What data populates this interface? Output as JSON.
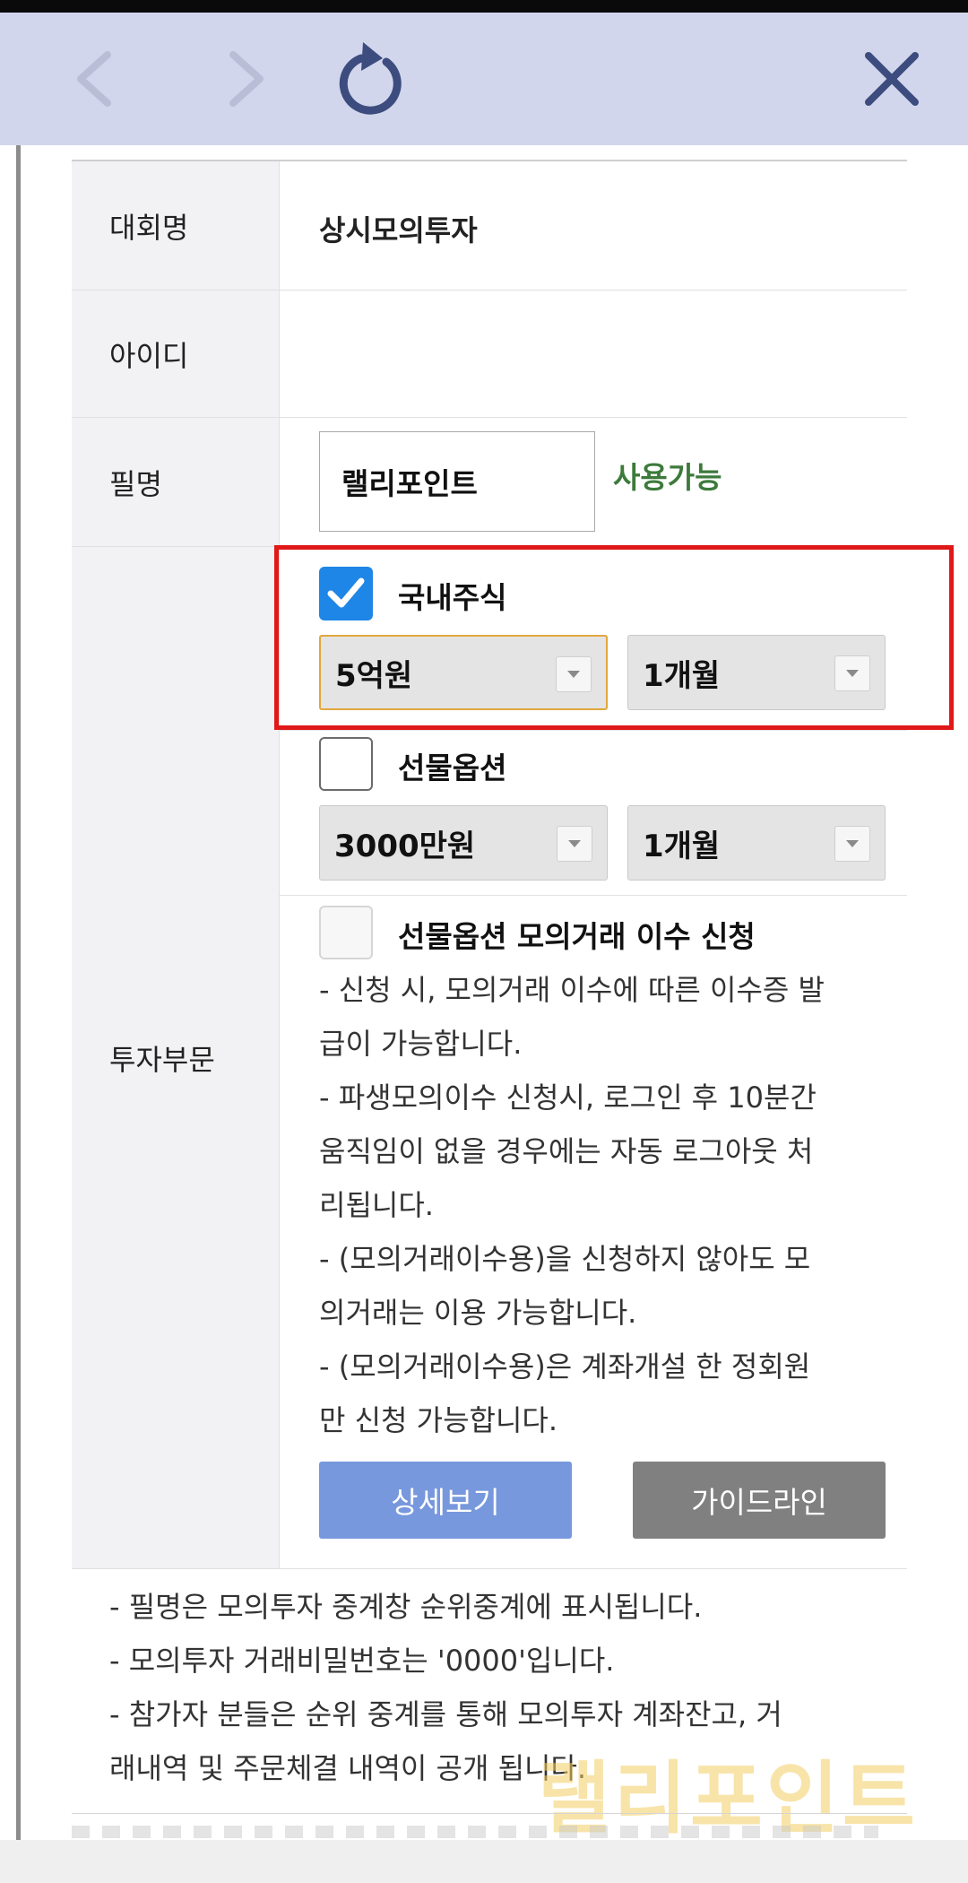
{
  "nav": {
    "back_icon": "chevron-left-icon",
    "forward_icon": "chevron-right-icon",
    "reload_icon": "reload-icon",
    "close_icon": "close-icon"
  },
  "form": {
    "contest_label": "대회명",
    "contest_value": "상시모의투자",
    "id_label": "아이디",
    "id_value": "",
    "nickname_label": "필명",
    "nickname_value": "랠리포인트",
    "nickname_status": "사용가능",
    "invest_label": "투자부문",
    "domestic": {
      "label": "국내주식",
      "checked": true,
      "amount": "5억원",
      "period": "1개월"
    },
    "futures": {
      "label": "선물옵션",
      "checked": false,
      "amount": "3000만원",
      "period": "1개월"
    },
    "transfer": {
      "label": "선물옵션 모의거래 이수 신청",
      "checked": false,
      "notes": [
        "- 신청 시, 모의거래 이수에 따른 이수증 발",
        "급이 가능합니다.",
        "- 파생모의이수 신청시, 로그인 후 10분간",
        "움직임이 없을 경우에는 자동 로그아웃 처",
        "리됩니다.",
        "- (모의거래이수용)을 신청하지 않아도 모",
        "의거래는 이용 가능합니다.",
        "- (모의거래이수용)은 계좌개설 한 정회원",
        "만 신청 가능합니다."
      ]
    },
    "detail_button": "상세보기",
    "guide_button": "가이드라인"
  },
  "bottom_notes": [
    "- 필명은 모의투자 중계창 순위중계에 표시됩니다.",
    "- 모의투자 거래비밀번호는 '0000'입니다.",
    "- 참가자 분들은 순위 중계를 통해 모의투자 계좌잔고, 거",
    "래내역 및 주문체결 내역이 공개 됩니다."
  ],
  "watermark": "랠리포인트",
  "colors": {
    "nav_bg": "#d2d6ec",
    "icon_active": "#3c4c7e",
    "icon_disabled": "#b9bdd6",
    "checkbox_blue": "#1e86e6",
    "available_green": "#3d7a3c",
    "highlight_red": "#e01818",
    "detail_btn": "#7798dd",
    "guide_btn": "#808080"
  }
}
